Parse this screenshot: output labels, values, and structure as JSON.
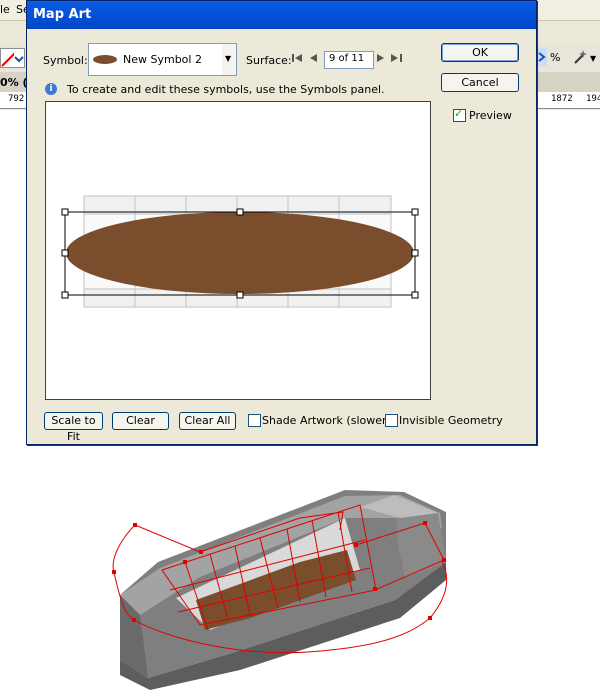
{
  "app": {
    "menu_partial": [
      "le",
      "Se"
    ],
    "zoom_partial": "0% (",
    "toolbar_percent": "%",
    "ruler_numbers": [
      "792",
      "1872",
      "194"
    ]
  },
  "dialog": {
    "title": "Map Art",
    "symbol_label": "Symbol:",
    "symbol_name": "New Symbol 2",
    "surface_label": "Surface:",
    "surface_value": "9 of 11",
    "info_text": "To create and edit these symbols, use the Symbols panel.",
    "ok_label": "OK",
    "cancel_label": "Cancel",
    "preview_label": "Preview",
    "preview_checked": true,
    "scale_to_fit_label": "Scale to Fit",
    "clear_label": "Clear",
    "clear_all_label": "Clear All",
    "shade_artwork_label": "Shade Artwork (slower)",
    "shade_artwork_checked": false,
    "invisible_geometry_label": "Invisible Geometry",
    "invisible_geometry_checked": false
  },
  "colors": {
    "symbol_brown": "#7a4e2d",
    "titlebar_blue": "#0054e3",
    "mesh_red": "#e00000",
    "dialog_bg": "#ece9d8"
  }
}
